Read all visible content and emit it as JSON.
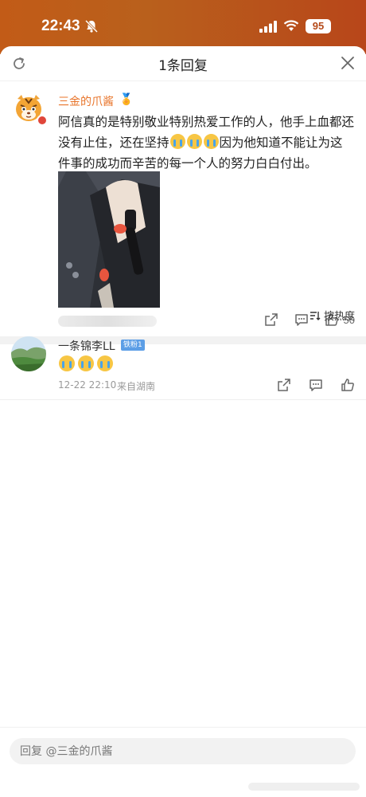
{
  "status_bar": {
    "time": "22:43",
    "battery": "95"
  },
  "header": {
    "title": "1条回复"
  },
  "original": {
    "username": "三金的爪酱",
    "medal": "🏅",
    "text_before": "阿信真的是特别敬业特别热爱工作的人，他手上血都还没有止住，还在坚持",
    "text_after": "因为他知道不能让为这件事的成功而辛苦的每一个人的努力白白付出。",
    "emoji_count": 3,
    "like_count": "50"
  },
  "sort": {
    "label": "按热度"
  },
  "reply": {
    "username": "一条锦李LL",
    "fan_badge": "铁粉1",
    "time": "12-22 22:10",
    "location": "来自湖南",
    "emoji_count": 3
  },
  "bottom": {
    "placeholder": "回复 @三金的爪酱"
  },
  "colors": {
    "accent_username": "#e8742a",
    "status_bar": "#b9601c",
    "fan_badge": "#5c9ee6"
  }
}
